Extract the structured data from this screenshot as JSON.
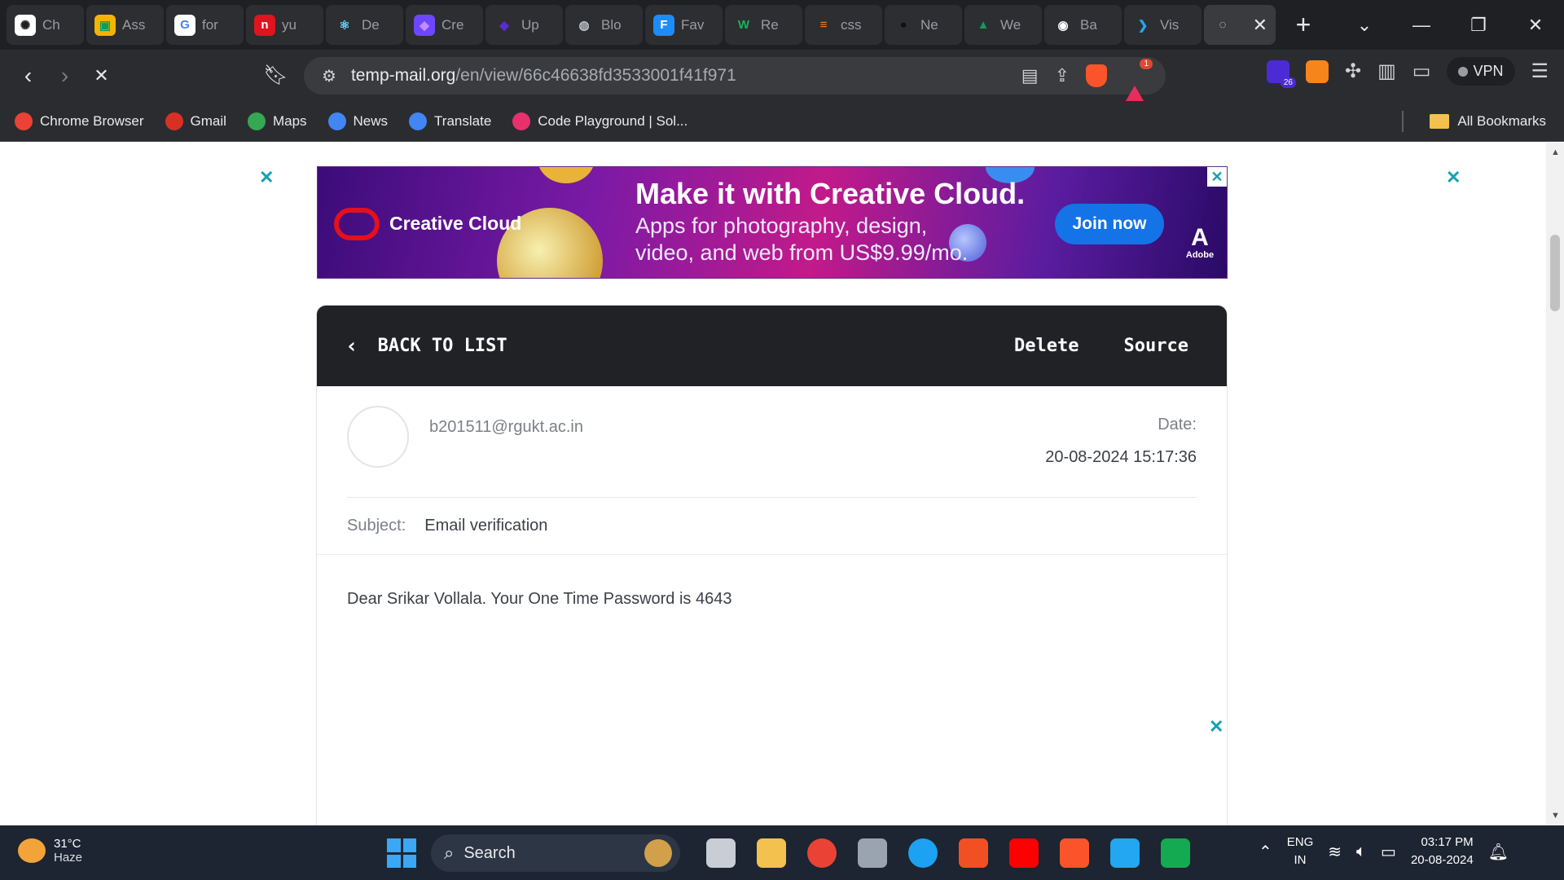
{
  "browser": {
    "tabs": [
      {
        "title": "Ch",
        "icon": "chatgpt-icon",
        "color": "#ffffff",
        "glyph": "✺",
        "fg": "#1f2023"
      },
      {
        "title": "Ass",
        "icon": "google-classroom-icon",
        "color": "#f4b400",
        "glyph": "▣",
        "fg": "#0f9d58"
      },
      {
        "title": "for",
        "icon": "google-icon",
        "color": "#ffffff",
        "glyph": "G",
        "fg": "#4285f4"
      },
      {
        "title": "yu",
        "icon": "n-icon",
        "color": "#e0141e",
        "glyph": "n",
        "fg": "#ffffff"
      },
      {
        "title": "De",
        "icon": "react-icon",
        "color": "#2d2e31",
        "glyph": "⚛",
        "fg": "#61dafb"
      },
      {
        "title": "Cre",
        "icon": "shield-icon",
        "color": "#6c47ff",
        "glyph": "◆",
        "fg": "#c18cff"
      },
      {
        "title": "Up",
        "icon": "gem-icon",
        "color": "#2d2e31",
        "glyph": "◆",
        "fg": "#5b2bd4"
      },
      {
        "title": "Blo",
        "icon": "globe-icon",
        "color": "#2d2e31",
        "glyph": "◍",
        "fg": "#bfc3ca"
      },
      {
        "title": "Fav",
        "icon": "f-icon",
        "color": "#1d8cf8",
        "glyph": "F",
        "fg": "#ffffff"
      },
      {
        "title": "Re",
        "icon": "w-icon",
        "color": "#2d2e31",
        "glyph": "W",
        "fg": "#19b35a"
      },
      {
        "title": "css",
        "icon": "stackoverflow-icon",
        "color": "#2d2e31",
        "glyph": "≡",
        "fg": "#f48024"
      },
      {
        "title": "Ne",
        "icon": "circle-icon",
        "color": "#2d2e31",
        "glyph": "●",
        "fg": "#111111"
      },
      {
        "title": "We",
        "icon": "google-drive-icon",
        "color": "#2d2e31",
        "glyph": "▲",
        "fg": "#0f9d58"
      },
      {
        "title": "Ba",
        "icon": "github-icon",
        "color": "#2d2e31",
        "glyph": "◉",
        "fg": "#ffffff"
      },
      {
        "title": "Vis",
        "icon": "vscode-icon",
        "color": "#2d2e31",
        "glyph": "❯",
        "fg": "#22a7f0"
      }
    ],
    "active_tab_icon": "loading-icon",
    "address": {
      "host": "temp-mail.org",
      "path": "/en/view/66c46638fd3533001f41f971"
    },
    "rewards_badge": "1",
    "extension_badge": "26",
    "vpn_label": "VPN",
    "bookmarks": [
      {
        "label": "Chrome Browser",
        "icon": "chrome-icon",
        "color": "#ea4335"
      },
      {
        "label": "Gmail",
        "icon": "gmail-icon",
        "color": "#d93025"
      },
      {
        "label": "Maps",
        "icon": "maps-icon",
        "color": "#34a853"
      },
      {
        "label": "News",
        "icon": "news-icon",
        "color": "#4285f4"
      },
      {
        "label": "Translate",
        "icon": "translate-icon",
        "color": "#4285f4"
      },
      {
        "label": "Code Playground | Sol...",
        "icon": "sololearn-icon",
        "color": "#e8306d"
      }
    ],
    "all_bookmarks_label": "All Bookmarks"
  },
  "ad": {
    "brand": "Creative Cloud",
    "headline": "Make it with Creative Cloud.",
    "subline": "Apps for photography, design, video, and web from US$9.99/mo.",
    "cta": "Join now",
    "vendor": "Adobe"
  },
  "mail": {
    "back_label": "BACK TO LIST",
    "delete_label": "Delete",
    "source_label": "Source",
    "sender": "b201511@rgukt.ac.in",
    "date_label": "Date:",
    "date_value": "20-08-2024 15:17:36",
    "subject_label": "Subject:",
    "subject_value": "Email verification",
    "body": "Dear Srikar Vollala. Your One Time Password is 4643"
  },
  "taskbar": {
    "temperature": "31°C",
    "condition": "Haze",
    "search_label": "Search",
    "lang_line1": "ENG",
    "lang_line2": "IN",
    "time": "03:17 PM",
    "date": "20-08-2024",
    "apps": [
      {
        "icon": "task-view-icon",
        "color": "#c9ced6"
      },
      {
        "icon": "file-explorer-icon",
        "color": "#f2c14e"
      },
      {
        "icon": "chrome-icon",
        "color": "#ea4335"
      },
      {
        "icon": "camera-icon",
        "color": "#9aa4b1"
      },
      {
        "icon": "cortana-icon",
        "color": "#1da1f2"
      },
      {
        "icon": "microsoft-store-icon",
        "color": "#f25022"
      },
      {
        "icon": "youtube-icon",
        "color": "#ff0000"
      },
      {
        "icon": "brave-icon",
        "color": "#fb542b"
      },
      {
        "icon": "vscode-icon",
        "color": "#22a7f0"
      },
      {
        "icon": "mongodb-icon",
        "color": "#13aa52"
      }
    ]
  }
}
